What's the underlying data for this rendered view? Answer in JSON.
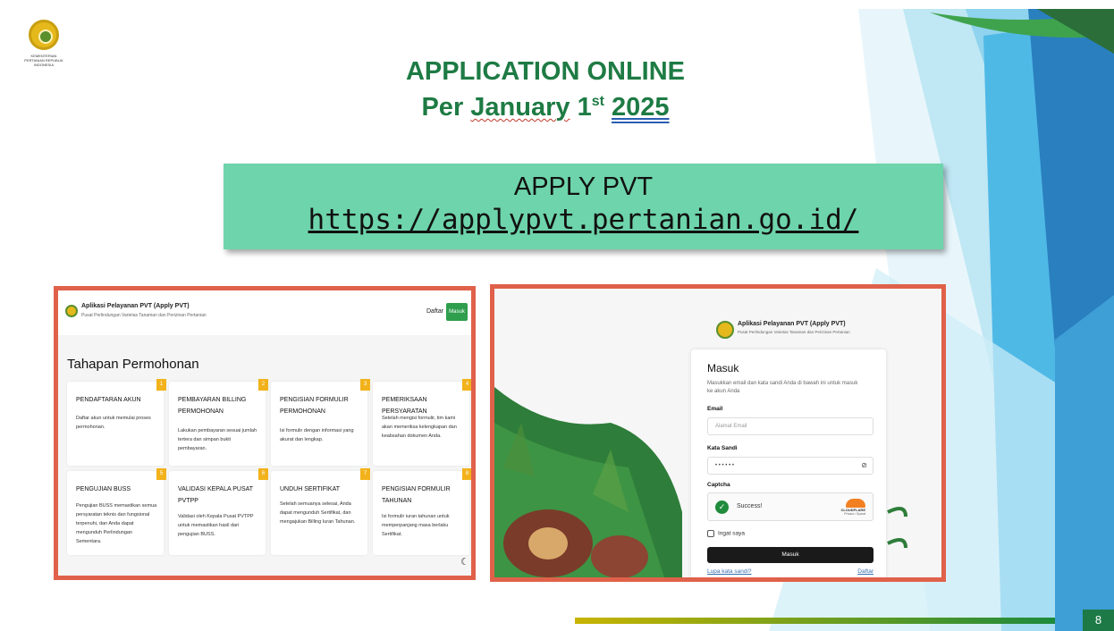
{
  "logo": {
    "text": "KEMENTERIAN PERTANIAN REPUBLIK INDONESIA"
  },
  "title": {
    "line1": "APPLICATION ONLINE",
    "line2_pre": "Per ",
    "line2_month": "January",
    "line2_day": " 1",
    "line2_sup": "st",
    "line2_year": "2025"
  },
  "banner": {
    "name": "APPLY PVT",
    "url": "https://applypvt.pertanian.go.id/"
  },
  "left_screenshot": {
    "app_title": "Aplikasi Pelayanan PVT (Apply PVT)",
    "app_subtitle": "Pusat Perlindungan Varietas Tanaman dan Perizinan Pertanian",
    "daftar": "Daftar",
    "masuk": "Masuk",
    "heading": "Tahapan Permohonan",
    "cards": [
      {
        "num": "1",
        "title": "PENDAFTARAN AKUN",
        "desc": "Daftar akun untuk memulai proses permohonan."
      },
      {
        "num": "2",
        "title": "PEMBAYARAN BILLING PERMOHONAN",
        "desc": "Lakukan pembayaran sesuai jumlah tertera dan simpan bukti pembayaran."
      },
      {
        "num": "3",
        "title": "PENGISIAN FORMULIR PERMOHONAN",
        "desc": "Isi formulir dengan informasi yang akurat dan lengkap."
      },
      {
        "num": "4",
        "title": "PEMERIKSAAN PERSYARATAN",
        "desc": "Setelah mengisi formulir, tim kami akan memeriksa kelengkapan dan keabsahan dokumen Anda."
      },
      {
        "num": "5",
        "title": "PENGUJIAN BUSS",
        "desc": "Pengujian BUSS memastikan semua persyaratan teknis dan fungsional terpenuhi, dan Anda dapat mengunduh Perlindungan Sementara."
      },
      {
        "num": "6",
        "title": "VALIDASI KEPALA PUSAT PVTPP",
        "desc": "Validasi oleh Kepala Pusat PVTPP untuk memastikan hasil dari pengujian BUSS."
      },
      {
        "num": "7",
        "title": "UNDUH SERTIFIKAT",
        "desc": "Setelah semuanya selesai, Anda dapat mengunduh Sertifikat, dan mengajukan Billing Iuran Tahunan."
      },
      {
        "num": "8",
        "title": "PENGISIAN FORMULIR TAHUNAN",
        "desc": "Isi formulir iuran tahunan untuk memperpanjang masa berlaku Sertifikat."
      }
    ],
    "theme_icon": "moon-icon"
  },
  "right_screenshot": {
    "app_title": "Aplikasi Pelayanan PVT (Apply PVT)",
    "app_subtitle": "Pusat Perlindungan Varietas Tanaman dan Perizinan Pertanian",
    "form": {
      "title": "Masuk",
      "desc": "Masukkan email dan kata sandi Anda di bawah ini untuk masuk ke akun Anda",
      "email_label": "Email",
      "email_placeholder": "Alamat Email",
      "password_label": "Kata Sandi",
      "password_value": "• • • • • •",
      "captcha_label": "Captcha",
      "captcha_status": "Success!",
      "captcha_brand": "CLOUDFLARE",
      "captcha_links": "Privasi • Syarat",
      "remember": "Ingat saya",
      "submit": "Masuk",
      "forgot": "Lupa kata sandi?",
      "register": "Daftar"
    }
  },
  "page_number": "8",
  "colors": {
    "title_green": "#1e7b44",
    "banner": "#6ed4ab",
    "frame": "#e0614a",
    "accent_orange": "#f2b21b"
  }
}
